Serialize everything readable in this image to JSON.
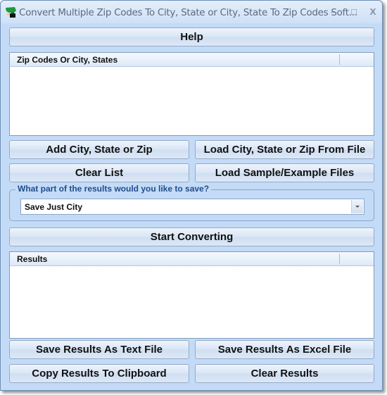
{
  "window": {
    "title": "Convert Multiple Zip Codes To City, State or City, State To Zip Codes Soft...",
    "controls": {
      "minimize": "–",
      "maximize": "□",
      "close": "X"
    }
  },
  "buttons": {
    "help": "Help",
    "add": "Add City, State or Zip",
    "load_file": "Load City, State or Zip From File",
    "clear_list": "Clear List",
    "load_sample": "Load Sample/Example Files",
    "start": "Start Converting",
    "save_text": "Save Results As Text File",
    "save_excel": "Save Results As Excel File",
    "copy": "Copy Results To Clipboard",
    "clear_results": "Clear Results"
  },
  "input_list": {
    "header": "Zip Codes Or City, States",
    "items": []
  },
  "save_option": {
    "label": "What part of the results would you like to save?",
    "selected": "Save Just City"
  },
  "results_list": {
    "header": "Results",
    "items": []
  }
}
